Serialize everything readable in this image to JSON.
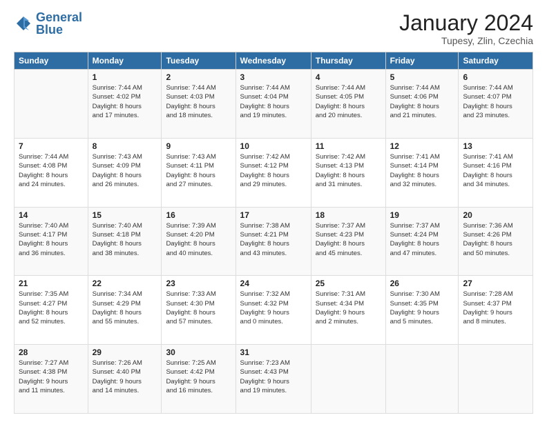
{
  "logo": {
    "line1": "General",
    "line2": "Blue"
  },
  "header": {
    "month": "January 2024",
    "location": "Tupesy, Zlin, Czechia"
  },
  "weekdays": [
    "Sunday",
    "Monday",
    "Tuesday",
    "Wednesday",
    "Thursday",
    "Friday",
    "Saturday"
  ],
  "weeks": [
    [
      {
        "day": "",
        "info": ""
      },
      {
        "day": "1",
        "info": "Sunrise: 7:44 AM\nSunset: 4:02 PM\nDaylight: 8 hours\nand 17 minutes."
      },
      {
        "day": "2",
        "info": "Sunrise: 7:44 AM\nSunset: 4:03 PM\nDaylight: 8 hours\nand 18 minutes."
      },
      {
        "day": "3",
        "info": "Sunrise: 7:44 AM\nSunset: 4:04 PM\nDaylight: 8 hours\nand 19 minutes."
      },
      {
        "day": "4",
        "info": "Sunrise: 7:44 AM\nSunset: 4:05 PM\nDaylight: 8 hours\nand 20 minutes."
      },
      {
        "day": "5",
        "info": "Sunrise: 7:44 AM\nSunset: 4:06 PM\nDaylight: 8 hours\nand 21 minutes."
      },
      {
        "day": "6",
        "info": "Sunrise: 7:44 AM\nSunset: 4:07 PM\nDaylight: 8 hours\nand 23 minutes."
      }
    ],
    [
      {
        "day": "7",
        "info": "Sunrise: 7:44 AM\nSunset: 4:08 PM\nDaylight: 8 hours\nand 24 minutes."
      },
      {
        "day": "8",
        "info": "Sunrise: 7:43 AM\nSunset: 4:09 PM\nDaylight: 8 hours\nand 26 minutes."
      },
      {
        "day": "9",
        "info": "Sunrise: 7:43 AM\nSunset: 4:11 PM\nDaylight: 8 hours\nand 27 minutes."
      },
      {
        "day": "10",
        "info": "Sunrise: 7:42 AM\nSunset: 4:12 PM\nDaylight: 8 hours\nand 29 minutes."
      },
      {
        "day": "11",
        "info": "Sunrise: 7:42 AM\nSunset: 4:13 PM\nDaylight: 8 hours\nand 31 minutes."
      },
      {
        "day": "12",
        "info": "Sunrise: 7:41 AM\nSunset: 4:14 PM\nDaylight: 8 hours\nand 32 minutes."
      },
      {
        "day": "13",
        "info": "Sunrise: 7:41 AM\nSunset: 4:16 PM\nDaylight: 8 hours\nand 34 minutes."
      }
    ],
    [
      {
        "day": "14",
        "info": "Sunrise: 7:40 AM\nSunset: 4:17 PM\nDaylight: 8 hours\nand 36 minutes."
      },
      {
        "day": "15",
        "info": "Sunrise: 7:40 AM\nSunset: 4:18 PM\nDaylight: 8 hours\nand 38 minutes."
      },
      {
        "day": "16",
        "info": "Sunrise: 7:39 AM\nSunset: 4:20 PM\nDaylight: 8 hours\nand 40 minutes."
      },
      {
        "day": "17",
        "info": "Sunrise: 7:38 AM\nSunset: 4:21 PM\nDaylight: 8 hours\nand 43 minutes."
      },
      {
        "day": "18",
        "info": "Sunrise: 7:37 AM\nSunset: 4:23 PM\nDaylight: 8 hours\nand 45 minutes."
      },
      {
        "day": "19",
        "info": "Sunrise: 7:37 AM\nSunset: 4:24 PM\nDaylight: 8 hours\nand 47 minutes."
      },
      {
        "day": "20",
        "info": "Sunrise: 7:36 AM\nSunset: 4:26 PM\nDaylight: 8 hours\nand 50 minutes."
      }
    ],
    [
      {
        "day": "21",
        "info": "Sunrise: 7:35 AM\nSunset: 4:27 PM\nDaylight: 8 hours\nand 52 minutes."
      },
      {
        "day": "22",
        "info": "Sunrise: 7:34 AM\nSunset: 4:29 PM\nDaylight: 8 hours\nand 55 minutes."
      },
      {
        "day": "23",
        "info": "Sunrise: 7:33 AM\nSunset: 4:30 PM\nDaylight: 8 hours\nand 57 minutes."
      },
      {
        "day": "24",
        "info": "Sunrise: 7:32 AM\nSunset: 4:32 PM\nDaylight: 9 hours\nand 0 minutes."
      },
      {
        "day": "25",
        "info": "Sunrise: 7:31 AM\nSunset: 4:34 PM\nDaylight: 9 hours\nand 2 minutes."
      },
      {
        "day": "26",
        "info": "Sunrise: 7:30 AM\nSunset: 4:35 PM\nDaylight: 9 hours\nand 5 minutes."
      },
      {
        "day": "27",
        "info": "Sunrise: 7:28 AM\nSunset: 4:37 PM\nDaylight: 9 hours\nand 8 minutes."
      }
    ],
    [
      {
        "day": "28",
        "info": "Sunrise: 7:27 AM\nSunset: 4:38 PM\nDaylight: 9 hours\nand 11 minutes."
      },
      {
        "day": "29",
        "info": "Sunrise: 7:26 AM\nSunset: 4:40 PM\nDaylight: 9 hours\nand 14 minutes."
      },
      {
        "day": "30",
        "info": "Sunrise: 7:25 AM\nSunset: 4:42 PM\nDaylight: 9 hours\nand 16 minutes."
      },
      {
        "day": "31",
        "info": "Sunrise: 7:23 AM\nSunset: 4:43 PM\nDaylight: 9 hours\nand 19 minutes."
      },
      {
        "day": "",
        "info": ""
      },
      {
        "day": "",
        "info": ""
      },
      {
        "day": "",
        "info": ""
      }
    ]
  ]
}
